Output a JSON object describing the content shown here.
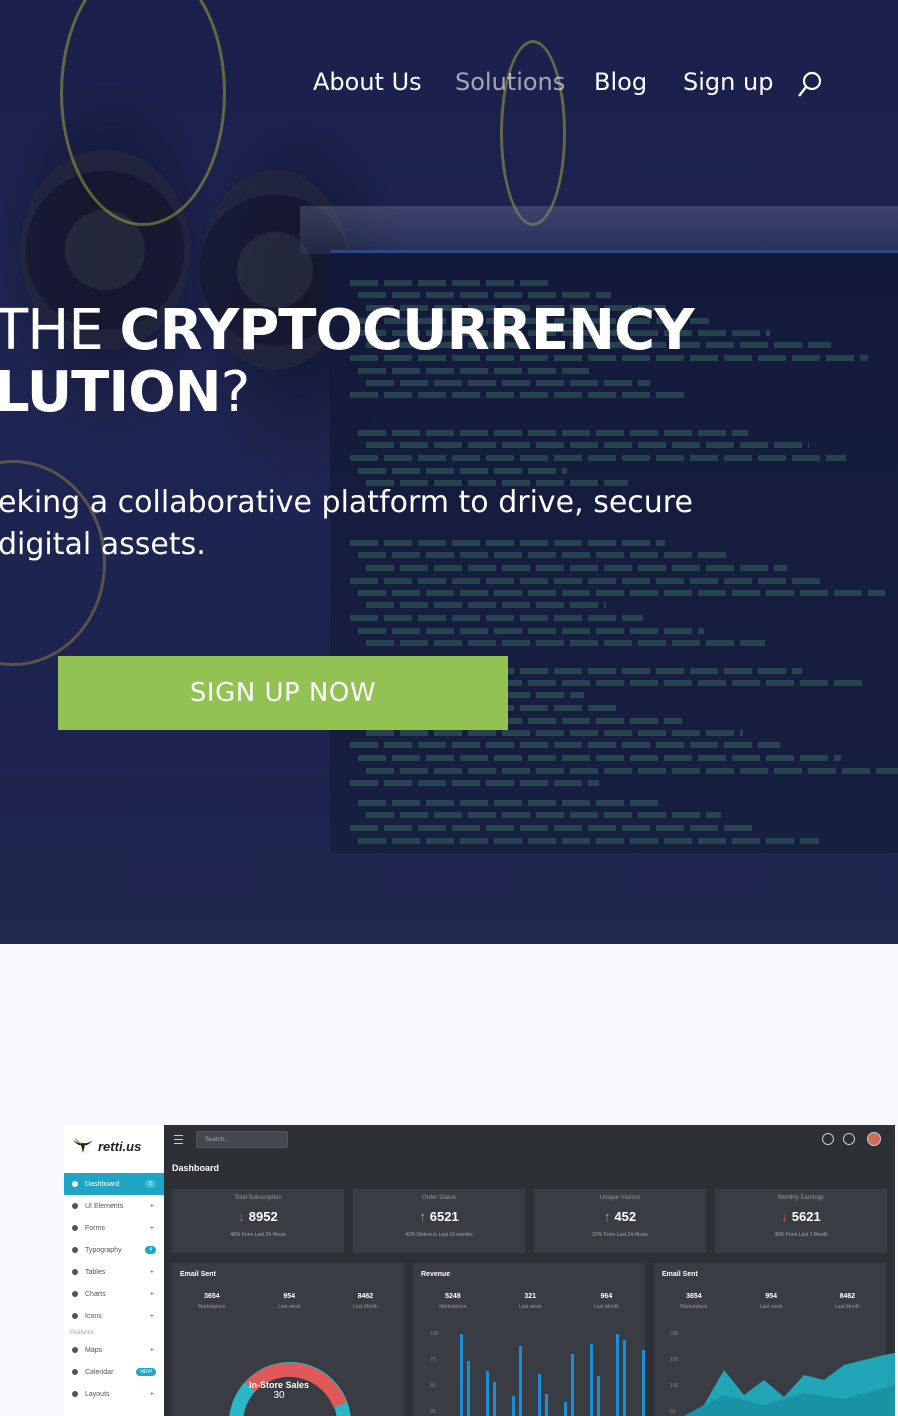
{
  "nav": {
    "items": [
      "About Us",
      "Solutions",
      "Blog",
      "Sign up"
    ],
    "search_icon": "search-icon"
  },
  "hero": {
    "headline_prefix": "THE ",
    "headline_bold1": "CRYPTOCURRENCY",
    "headline_bold2": "LUTION",
    "headline_end": "?",
    "subtext": "eking a collaborative platform to drive, secure\n digital assets.",
    "cta_label": "SIGN UP NOW",
    "cta_color": "#92c352"
  },
  "dashboard": {
    "logo_text": "retti.us",
    "search_placeholder": "Search...",
    "title": "Dashboard",
    "menu": [
      {
        "label": "Dashboard",
        "badge": "5"
      },
      {
        "label": "UI Elements",
        "mark": "+"
      },
      {
        "label": "Forms",
        "mark": "+"
      },
      {
        "label": "Typography",
        "badge": "4"
      },
      {
        "label": "Tables",
        "mark": "+"
      },
      {
        "label": "Charts",
        "mark": "+"
      },
      {
        "label": "Icons",
        "mark": "+"
      }
    ],
    "features_label": "Features",
    "menu2": [
      {
        "label": "Maps",
        "mark": "+"
      },
      {
        "label": "Calendar",
        "badge": "NEW"
      },
      {
        "label": "Layouts",
        "mark": "+"
      }
    ],
    "stats": [
      {
        "title": "Total Subscription",
        "value": "8952",
        "dir": "down",
        "sub": "48% From Last 24 Hours"
      },
      {
        "title": "Order Status",
        "value": "6521",
        "dir": "up",
        "sub": "42% Orders in Last 10 months"
      },
      {
        "title": "Unique Visitors",
        "value": "452",
        "dir": "up",
        "sub": "22% From Last 24 Hours"
      },
      {
        "title": "Monthly Earnings",
        "value": "5621",
        "dir": "down",
        "sub": "35% From Last 1 Month"
      }
    ],
    "cards": [
      {
        "title": "Email Sent",
        "cols": [
          {
            "v": "3654",
            "l": "Marketplace"
          },
          {
            "v": "954",
            "l": "Last week"
          },
          {
            "v": "8462",
            "l": "Last Month"
          }
        ]
      },
      {
        "title": "Revenue",
        "cols": [
          {
            "v": "5248",
            "l": "Marketplace"
          },
          {
            "v": "321",
            "l": "Last week"
          },
          {
            "v": "964",
            "l": "Last Month"
          }
        ]
      },
      {
        "title": "Email Sent",
        "cols": [
          {
            "v": "3654",
            "l": "Marketplace"
          },
          {
            "v": "954",
            "l": "Last week"
          },
          {
            "v": "8462",
            "l": "Last Month"
          }
        ]
      }
    ],
    "donut": {
      "label": "In-Store Sales",
      "value": "30"
    },
    "revenue_axis": [
      "100",
      "75",
      "50",
      "25"
    ],
    "area_axis": [
      "200",
      "150",
      "100",
      "50"
    ],
    "colors": {
      "accent": "#1ea6c4",
      "donut_red": "#e05858",
      "bar_blue": "#1a8fd6",
      "area_teal": "#2ab8c8"
    }
  }
}
